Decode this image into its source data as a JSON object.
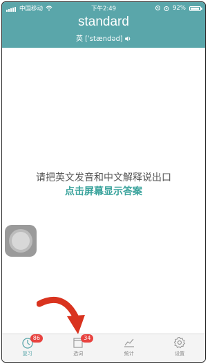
{
  "status": {
    "carrier": "中国移动",
    "time": "下午2:49",
    "battery": "92%",
    "battery_level": 0.92
  },
  "word": {
    "text": "standard",
    "phonetic": "英 [ˈstændəd]",
    "speaker_icon": "speaker-icon"
  },
  "main": {
    "prompt": "请把英文发音和中文解释说出口",
    "reveal": "点击屏幕显示答案"
  },
  "tabs": [
    {
      "label": "复习",
      "icon": "review-timer-icon",
      "badge": "86",
      "active": true
    },
    {
      "label": "选词",
      "icon": "word-select-icon",
      "badge": "34",
      "active": false
    },
    {
      "label": "统计",
      "icon": "stats-chart-icon",
      "badge": "",
      "active": false
    },
    {
      "label": "设置",
      "icon": "gear-icon",
      "badge": "",
      "active": false
    }
  ],
  "colors": {
    "header": "#5aa6aa",
    "answer": "#3aa39c",
    "badge": "#e8423f",
    "arrow": "#d9331f"
  }
}
